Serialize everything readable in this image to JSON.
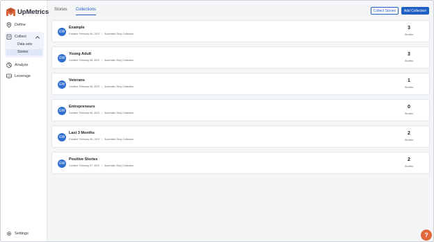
{
  "brand": {
    "name": "UpMetrics",
    "accent": "#1f5fc4",
    "logo_color": "#e0683a"
  },
  "sidebar": {
    "define": "Define",
    "collect": "Collect",
    "collect_items": [
      "Data sets",
      "Stories"
    ],
    "analyze": "Analyze",
    "leverage": "Leverage",
    "settings": "Settings"
  },
  "tabs": {
    "stories": "Stories",
    "collections": "Collections"
  },
  "buttons": {
    "collect_stories": "Collect Stories",
    "add_collection": "Add Collection"
  },
  "collections": [
    {
      "initials": "GW",
      "title": "Example",
      "created": "Created: February 08, 2023",
      "type": "Automatic Story Collection",
      "count": "3",
      "count_label": "Stories"
    },
    {
      "initials": "GW",
      "title": "Young Adult",
      "created": "Created: February 08, 2023",
      "type": "Automatic Story Collection",
      "count": "3",
      "count_label": "Stories"
    },
    {
      "initials": "GW",
      "title": "Veterans",
      "created": "Created: February 08, 2023",
      "type": "Automatic Story Collection",
      "count": "1",
      "count_label": "Stories"
    },
    {
      "initials": "GW",
      "title": "Entrepreneurs",
      "created": "Created: February 08, 2023",
      "type": "Automatic Story Collection",
      "count": "0",
      "count_label": "Stories"
    },
    {
      "initials": "GW",
      "title": "Last 3 Months",
      "created": "Created: February 08, 2023",
      "type": "Automatic Story Collection",
      "count": "2",
      "count_label": "Stories"
    },
    {
      "initials": "GW",
      "title": "Positive Stories",
      "created": "Created: February 07, 2023",
      "type": "Automatic Story Collection",
      "count": "2",
      "count_label": "Stories"
    }
  ],
  "help": {
    "symbol": "?"
  }
}
